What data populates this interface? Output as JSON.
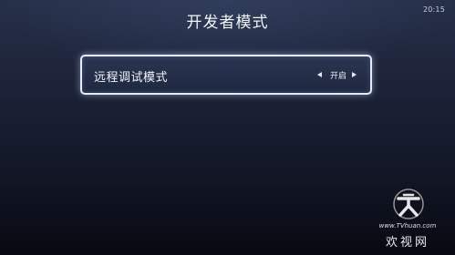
{
  "status_bar": {
    "time": "20:15"
  },
  "page": {
    "title": "开发者模式"
  },
  "settings": [
    {
      "label": "远程调试模式",
      "value": "开启",
      "focused": true
    }
  ],
  "watermark": {
    "url": "www.TVhuan.com",
    "name": "欢视网"
  },
  "colors": {
    "background_top": "#263049",
    "background_bottom": "#070910",
    "focus_border": "#e6ecf7",
    "text": "#ffffff"
  },
  "icons": {
    "prev": "left-arrow-icon",
    "next": "right-arrow-icon",
    "logo": "tvhuan-logo-icon"
  }
}
